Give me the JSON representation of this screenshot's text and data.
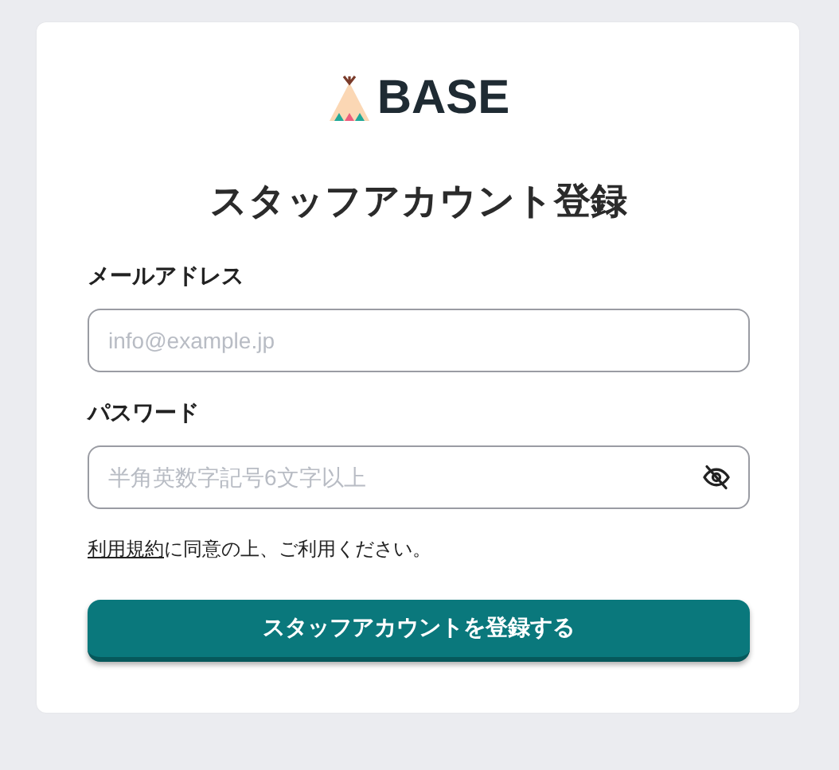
{
  "logo": {
    "text": "BASE"
  },
  "title": "スタッフアカウント登録",
  "fields": [
    {
      "label": "メールアドレス",
      "placeholder": "info@example.jp",
      "kind": "email"
    },
    {
      "label": "パスワード",
      "placeholder": "半角英数字記号6文字以上",
      "kind": "password"
    }
  ],
  "terms": {
    "link": "利用規約",
    "text": "に同意の上、ご利用ください。"
  },
  "submit_button": "スタッフアカウントを登録する"
}
